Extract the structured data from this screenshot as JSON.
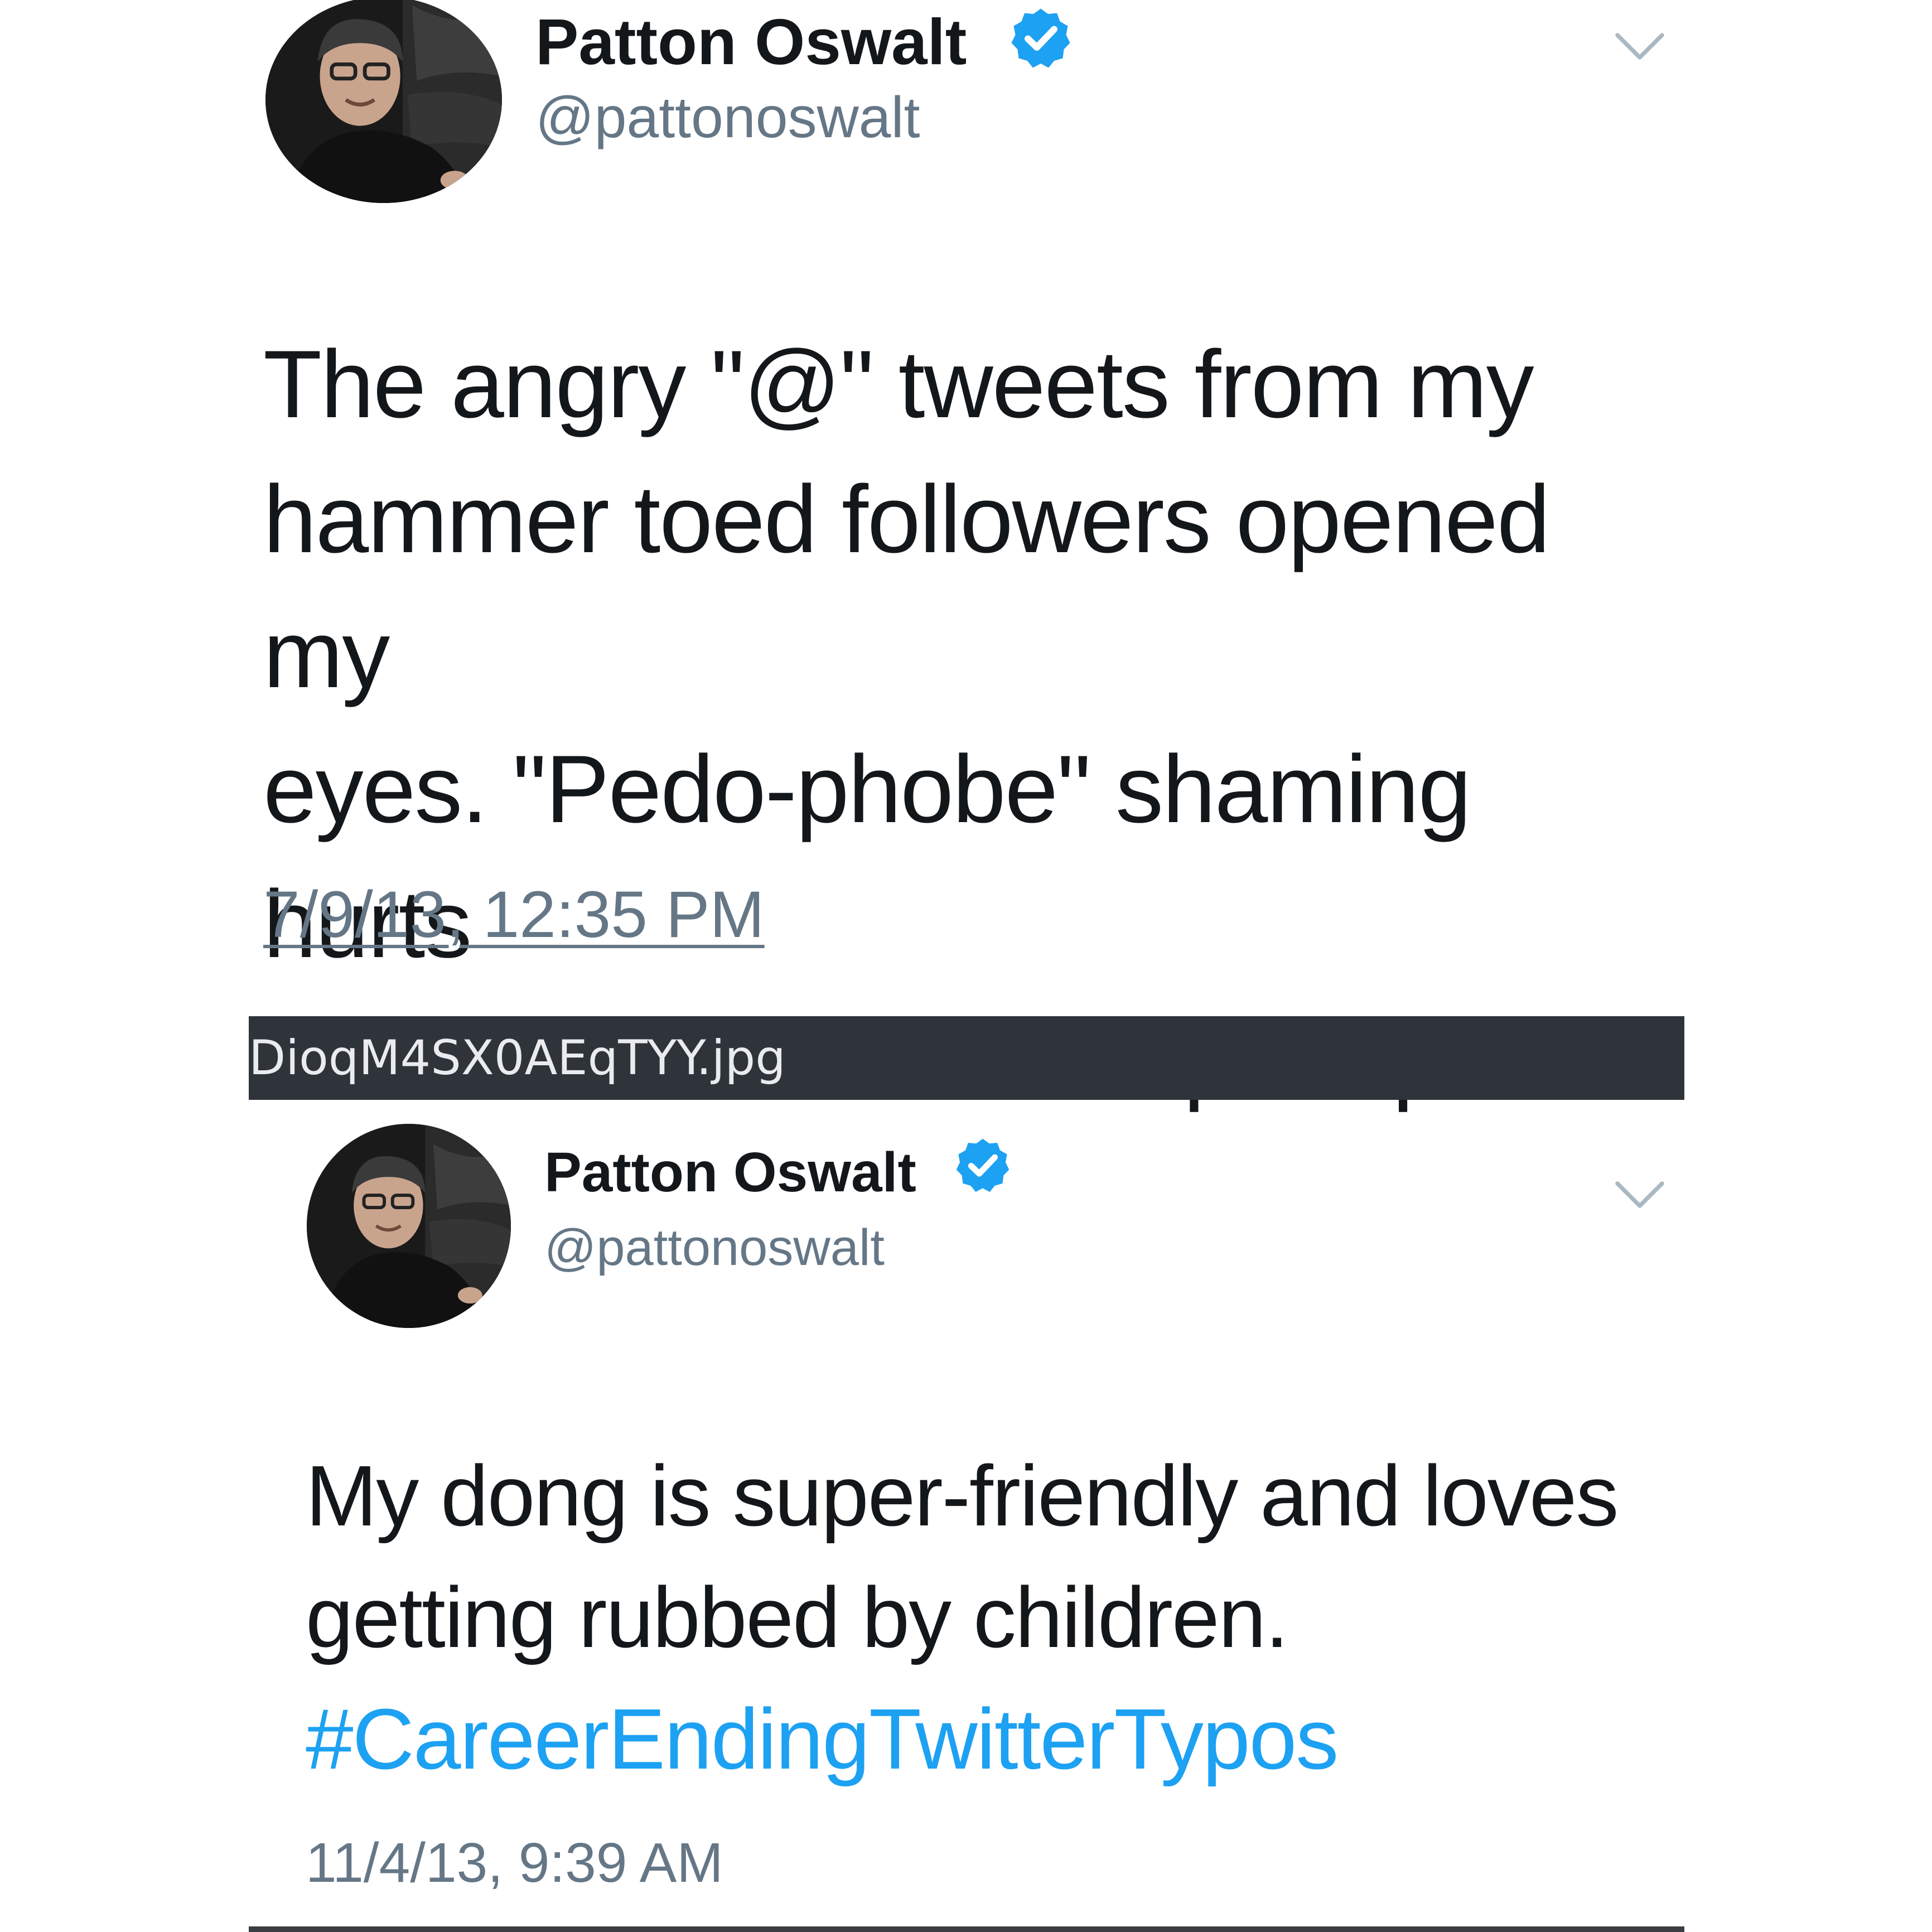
{
  "colors": {
    "text": "#14171a",
    "secondary_text": "#657786",
    "link_blue": "#1da1f2",
    "verified_blue": "#1da1f2",
    "filename_bar": "#2f333a"
  },
  "tweets": [
    {
      "author": {
        "name": "Patton Oswalt",
        "handle": "@pattonoswalt",
        "verified": true,
        "avatar_icon": "avatar-photo",
        "verified_icon": "verified-badge-icon"
      },
      "text": "The angry \"@\" tweets from my\nhammer toed followers opened my\neyes. \"Pedo-phobe\" shaming hurts\nus all. I am a PROUD pedophile!",
      "hashtag": "",
      "timestamp": "7/9/13, 12:35 PM",
      "menu_icon": "chevron-down-icon"
    },
    {
      "author": {
        "name": "Patton Oswalt",
        "handle": "@pattonoswalt",
        "verified": true,
        "avatar_icon": "avatar-photo",
        "verified_icon": "verified-badge-icon"
      },
      "text": "My dong is super-friendly and loves\ngetting rubbed by children.",
      "hashtag": "#CareerEndingTwitterTypos",
      "timestamp": "11/4/13, 9:39 AM",
      "menu_icon": "chevron-down-icon"
    }
  ],
  "filename_bar": {
    "label": "DioqM4SX0AEqTYY.jpg"
  }
}
